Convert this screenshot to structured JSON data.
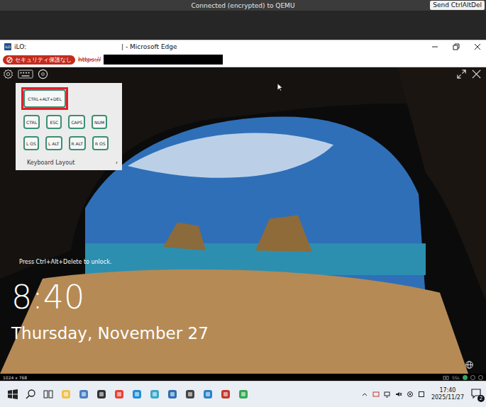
{
  "vnc_bar": {
    "status": "Connected (encrypted) to QEMU",
    "send_button": "Send CtrlAltDel"
  },
  "browser": {
    "favicon": "iLO",
    "title": "iLO:",
    "title_suffix": "| - Microsoft Edge",
    "security_label": "セキュリティ保護なし",
    "url_scheme": "https://",
    "url_redacted": true
  },
  "console": {
    "keyboard_menu": {
      "open": true,
      "key_rows": [
        [
          {
            "label": "CTRL+ALT+DEL",
            "highlighted": true
          }
        ],
        [
          {
            "label": "CTRL",
            "highlighted": false
          },
          {
            "label": "ESC",
            "highlighted": false
          },
          {
            "label": "CAPS",
            "highlighted": false
          },
          {
            "label": "NUM",
            "highlighted": false
          }
        ],
        [
          {
            "label": "L OS",
            "highlighted": false
          },
          {
            "label": "L ALT",
            "highlighted": false
          },
          {
            "label": "R ALT",
            "highlighted": false
          },
          {
            "label": "R OS",
            "highlighted": false
          }
        ]
      ],
      "layout_item": {
        "label": "Keyboard Layout",
        "arrow": "›"
      }
    },
    "resolution": "1024 x 768",
    "security": "SSL"
  },
  "lock_screen": {
    "hint": "Press Ctrl+Alt+Delete to unlock.",
    "time": "8:40",
    "date": "Thursday, November 27"
  },
  "taskbar": {
    "clock_time": "17:40",
    "clock_date": "2025/11/27",
    "notification_count": "2"
  }
}
